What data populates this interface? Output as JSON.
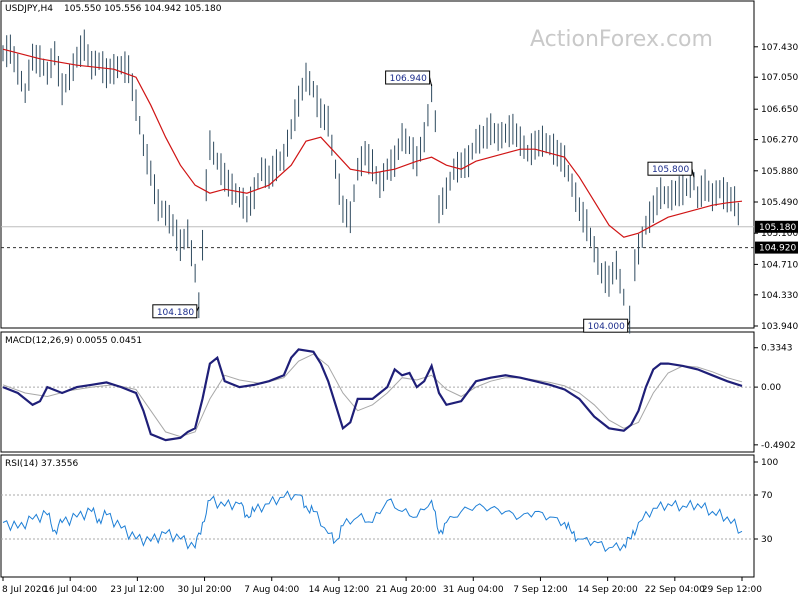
{
  "header": {
    "symbol": "USDJPY,H4",
    "ohlc": "105.550 105.556 104.942 105.180"
  },
  "watermark": "ActionForex.com",
  "chart_data": [
    {
      "type": "line",
      "name": "price",
      "ylim": [
        103.94,
        107.64
      ],
      "y_ticks": [
        "107.430",
        "107.050",
        "106.650",
        "106.270",
        "105.880",
        "105.490",
        "105.100",
        "104.710",
        "104.330",
        "103.940"
      ],
      "tick_values": [
        107.43,
        107.05,
        106.65,
        106.27,
        105.88,
        105.49,
        105.1,
        104.71,
        104.33,
        103.94
      ],
      "current_price_label": "105.180",
      "current_price": 105.18,
      "dashed_level_label": "104.920",
      "dashed_level": 104.92,
      "price_line_color": "#2e4a5e",
      "ma_line_color": "#d01515",
      "callouts": [
        {
          "label": "106.940",
          "value": 106.94,
          "t": 0.58
        },
        {
          "label": "104.180",
          "value": 104.18,
          "t": 0.265
        },
        {
          "label": "105.800",
          "value": 105.8,
          "t": 0.935
        },
        {
          "label": "104.000",
          "value": 104.0,
          "t": 0.848
        }
      ],
      "price_path": [
        [
          0.0,
          107.35
        ],
        [
          0.01,
          107.4
        ],
        [
          0.02,
          107.15
        ],
        [
          0.03,
          106.85
        ],
        [
          0.04,
          107.3
        ],
        [
          0.05,
          107.25
        ],
        [
          0.06,
          107.1
        ],
        [
          0.07,
          107.35
        ],
        [
          0.08,
          106.9
        ],
        [
          0.09,
          107.05
        ],
        [
          0.1,
          107.3
        ],
        [
          0.11,
          107.45
        ],
        [
          0.12,
          107.2
        ],
        [
          0.13,
          107.25
        ],
        [
          0.14,
          107.1
        ],
        [
          0.15,
          107.15
        ],
        [
          0.16,
          107.2
        ],
        [
          0.17,
          107.15
        ],
        [
          0.18,
          106.7
        ],
        [
          0.19,
          106.2
        ],
        [
          0.2,
          105.85
        ],
        [
          0.21,
          105.45
        ],
        [
          0.22,
          105.35
        ],
        [
          0.23,
          105.2
        ],
        [
          0.24,
          104.95
        ],
        [
          0.25,
          105.1
        ],
        [
          0.26,
          104.6
        ],
        [
          0.265,
          104.2
        ],
        [
          0.27,
          104.95
        ],
        [
          0.275,
          105.7
        ],
        [
          0.28,
          106.2
        ],
        [
          0.29,
          106.0
        ],
        [
          0.3,
          105.8
        ],
        [
          0.31,
          105.65
        ],
        [
          0.32,
          105.55
        ],
        [
          0.33,
          105.4
        ],
        [
          0.34,
          105.6
        ],
        [
          0.35,
          105.9
        ],
        [
          0.36,
          105.8
        ],
        [
          0.37,
          105.95
        ],
        [
          0.38,
          106.05
        ],
        [
          0.39,
          106.4
        ],
        [
          0.4,
          106.75
        ],
        [
          0.41,
          107.05
        ],
        [
          0.42,
          106.9
        ],
        [
          0.43,
          106.6
        ],
        [
          0.44,
          106.5
        ],
        [
          0.45,
          105.9
        ],
        [
          0.46,
          105.4
        ],
        [
          0.47,
          105.3
        ],
        [
          0.48,
          105.9
        ],
        [
          0.49,
          106.1
        ],
        [
          0.5,
          105.95
        ],
        [
          0.51,
          105.7
        ],
        [
          0.52,
          105.9
        ],
        [
          0.53,
          106.0
        ],
        [
          0.54,
          106.3
        ],
        [
          0.55,
          106.2
        ],
        [
          0.56,
          106.0
        ],
        [
          0.57,
          106.3
        ],
        [
          0.58,
          106.85
        ],
        [
          0.585,
          106.5
        ],
        [
          0.59,
          105.4
        ],
        [
          0.6,
          105.6
        ],
        [
          0.61,
          105.9
        ],
        [
          0.62,
          105.95
        ],
        [
          0.63,
          106.0
        ],
        [
          0.64,
          106.25
        ],
        [
          0.65,
          106.3
        ],
        [
          0.66,
          106.4
        ],
        [
          0.67,
          106.3
        ],
        [
          0.68,
          106.35
        ],
        [
          0.69,
          106.4
        ],
        [
          0.7,
          106.25
        ],
        [
          0.71,
          106.1
        ],
        [
          0.72,
          106.2
        ],
        [
          0.73,
          106.25
        ],
        [
          0.74,
          106.2
        ],
        [
          0.75,
          106.1
        ],
        [
          0.76,
          106.0
        ],
        [
          0.77,
          105.7
        ],
        [
          0.78,
          105.4
        ],
        [
          0.79,
          105.2
        ],
        [
          0.8,
          104.9
        ],
        [
          0.81,
          104.6
        ],
        [
          0.82,
          104.5
        ],
        [
          0.83,
          104.7
        ],
        [
          0.84,
          104.3
        ],
        [
          0.848,
          104.02
        ],
        [
          0.855,
          104.7
        ],
        [
          0.86,
          104.9
        ],
        [
          0.87,
          105.2
        ],
        [
          0.88,
          105.4
        ],
        [
          0.89,
          105.6
        ],
        [
          0.9,
          105.55
        ],
        [
          0.91,
          105.6
        ],
        [
          0.92,
          105.65
        ],
        [
          0.93,
          105.7
        ],
        [
          0.935,
          105.75
        ],
        [
          0.94,
          105.55
        ],
        [
          0.95,
          105.7
        ],
        [
          0.96,
          105.55
        ],
        [
          0.97,
          105.65
        ],
        [
          0.98,
          105.55
        ],
        [
          0.99,
          105.5
        ],
        [
          1.0,
          105.18
        ]
      ],
      "ma_path": [
        [
          0.0,
          107.4
        ],
        [
          0.05,
          107.28
        ],
        [
          0.1,
          107.2
        ],
        [
          0.15,
          107.15
        ],
        [
          0.18,
          107.05
        ],
        [
          0.2,
          106.7
        ],
        [
          0.22,
          106.3
        ],
        [
          0.24,
          105.95
        ],
        [
          0.26,
          105.7
        ],
        [
          0.28,
          105.6
        ],
        [
          0.3,
          105.65
        ],
        [
          0.33,
          105.6
        ],
        [
          0.36,
          105.7
        ],
        [
          0.39,
          105.95
        ],
        [
          0.41,
          106.25
        ],
        [
          0.43,
          106.3
        ],
        [
          0.45,
          106.1
        ],
        [
          0.47,
          105.9
        ],
        [
          0.5,
          105.85
        ],
        [
          0.53,
          105.9
        ],
        [
          0.56,
          106.0
        ],
        [
          0.58,
          106.05
        ],
        [
          0.6,
          105.95
        ],
        [
          0.62,
          105.9
        ],
        [
          0.64,
          106.0
        ],
        [
          0.66,
          106.05
        ],
        [
          0.68,
          106.1
        ],
        [
          0.7,
          106.15
        ],
        [
          0.72,
          106.15
        ],
        [
          0.74,
          106.1
        ],
        [
          0.76,
          106.05
        ],
        [
          0.78,
          105.8
        ],
        [
          0.8,
          105.5
        ],
        [
          0.82,
          105.2
        ],
        [
          0.84,
          105.05
        ],
        [
          0.86,
          105.1
        ],
        [
          0.88,
          105.2
        ],
        [
          0.9,
          105.3
        ],
        [
          0.92,
          105.35
        ],
        [
          0.94,
          105.4
        ],
        [
          0.96,
          105.45
        ],
        [
          0.98,
          105.48
        ],
        [
          1.0,
          105.5
        ]
      ]
    },
    {
      "type": "line",
      "name": "MACD(12,26,9) 0.0055 0.0451",
      "ylim": [
        -0.5,
        0.4
      ],
      "y_ticks": [
        "0.3343",
        "0.00",
        "-0.4902"
      ],
      "tick_values": [
        0.3343,
        0.0,
        -0.4902
      ],
      "macd_color": "#1f1f78",
      "signal_color": "#a8a8a8",
      "macd_path": [
        [
          0.0,
          0.0
        ],
        [
          0.02,
          -0.05
        ],
        [
          0.04,
          -0.15
        ],
        [
          0.05,
          -0.12
        ],
        [
          0.06,
          0.0
        ],
        [
          0.08,
          -0.05
        ],
        [
          0.1,
          0.0
        ],
        [
          0.12,
          0.02
        ],
        [
          0.14,
          0.04
        ],
        [
          0.16,
          0.0
        ],
        [
          0.18,
          -0.05
        ],
        [
          0.19,
          -0.2
        ],
        [
          0.2,
          -0.4
        ],
        [
          0.22,
          -0.45
        ],
        [
          0.24,
          -0.43
        ],
        [
          0.25,
          -0.38
        ],
        [
          0.26,
          -0.35
        ],
        [
          0.27,
          -0.1
        ],
        [
          0.28,
          0.2
        ],
        [
          0.29,
          0.25
        ],
        [
          0.3,
          0.05
        ],
        [
          0.32,
          0.0
        ],
        [
          0.34,
          0.02
        ],
        [
          0.36,
          0.05
        ],
        [
          0.38,
          0.1
        ],
        [
          0.39,
          0.25
        ],
        [
          0.4,
          0.32
        ],
        [
          0.42,
          0.3
        ],
        [
          0.43,
          0.2
        ],
        [
          0.44,
          0.05
        ],
        [
          0.45,
          -0.15
        ],
        [
          0.46,
          -0.35
        ],
        [
          0.47,
          -0.3
        ],
        [
          0.48,
          -0.1
        ],
        [
          0.5,
          -0.1
        ],
        [
          0.52,
          0.0
        ],
        [
          0.53,
          0.15
        ],
        [
          0.54,
          0.1
        ],
        [
          0.55,
          0.12
        ],
        [
          0.56,
          0.0
        ],
        [
          0.57,
          0.05
        ],
        [
          0.58,
          0.18
        ],
        [
          0.59,
          -0.05
        ],
        [
          0.6,
          -0.15
        ],
        [
          0.62,
          -0.12
        ],
        [
          0.64,
          0.05
        ],
        [
          0.66,
          0.08
        ],
        [
          0.68,
          0.1
        ],
        [
          0.7,
          0.08
        ],
        [
          0.72,
          0.05
        ],
        [
          0.74,
          0.02
        ],
        [
          0.76,
          -0.02
        ],
        [
          0.78,
          -0.1
        ],
        [
          0.8,
          -0.25
        ],
        [
          0.82,
          -0.35
        ],
        [
          0.84,
          -0.37
        ],
        [
          0.85,
          -0.32
        ],
        [
          0.86,
          -0.2
        ],
        [
          0.87,
          0.0
        ],
        [
          0.88,
          0.15
        ],
        [
          0.89,
          0.2
        ],
        [
          0.9,
          0.2
        ],
        [
          0.92,
          0.18
        ],
        [
          0.94,
          0.15
        ],
        [
          0.96,
          0.1
        ],
        [
          0.98,
          0.05
        ],
        [
          1.0,
          0.01
        ]
      ],
      "signal_path": [
        [
          0.0,
          0.02
        ],
        [
          0.03,
          -0.05
        ],
        [
          0.06,
          -0.08
        ],
        [
          0.09,
          -0.03
        ],
        [
          0.12,
          0.0
        ],
        [
          0.15,
          0.02
        ],
        [
          0.18,
          -0.02
        ],
        [
          0.2,
          -0.2
        ],
        [
          0.22,
          -0.38
        ],
        [
          0.24,
          -0.42
        ],
        [
          0.26,
          -0.38
        ],
        [
          0.28,
          -0.1
        ],
        [
          0.3,
          0.1
        ],
        [
          0.32,
          0.06
        ],
        [
          0.35,
          0.03
        ],
        [
          0.38,
          0.08
        ],
        [
          0.4,
          0.22
        ],
        [
          0.42,
          0.28
        ],
        [
          0.44,
          0.18
        ],
        [
          0.46,
          -0.05
        ],
        [
          0.48,
          -0.2
        ],
        [
          0.5,
          -0.15
        ],
        [
          0.52,
          -0.05
        ],
        [
          0.54,
          0.08
        ],
        [
          0.56,
          0.06
        ],
        [
          0.58,
          0.1
        ],
        [
          0.6,
          -0.02
        ],
        [
          0.62,
          -0.08
        ],
        [
          0.64,
          0.0
        ],
        [
          0.66,
          0.05
        ],
        [
          0.68,
          0.08
        ],
        [
          0.7,
          0.08
        ],
        [
          0.72,
          0.06
        ],
        [
          0.74,
          0.04
        ],
        [
          0.76,
          0.01
        ],
        [
          0.78,
          -0.05
        ],
        [
          0.8,
          -0.15
        ],
        [
          0.82,
          -0.28
        ],
        [
          0.84,
          -0.35
        ],
        [
          0.86,
          -0.3
        ],
        [
          0.88,
          -0.05
        ],
        [
          0.9,
          0.12
        ],
        [
          0.92,
          0.18
        ],
        [
          0.94,
          0.17
        ],
        [
          0.96,
          0.13
        ],
        [
          0.98,
          0.08
        ],
        [
          1.0,
          0.045
        ]
      ]
    },
    {
      "type": "line",
      "name": "RSI(14) 37.3556",
      "ylim": [
        0,
        100
      ],
      "y_ticks": [
        "100",
        "70",
        "30"
      ],
      "tick_values": [
        100,
        70,
        30
      ],
      "rsi_color": "#1e7fd6",
      "rsi_path": [
        [
          0.0,
          45
        ],
        [
          0.02,
          40
        ],
        [
          0.04,
          48
        ],
        [
          0.06,
          52
        ],
        [
          0.07,
          38
        ],
        [
          0.08,
          45
        ],
        [
          0.1,
          50
        ],
        [
          0.12,
          55
        ],
        [
          0.13,
          48
        ],
        [
          0.14,
          52
        ],
        [
          0.16,
          40
        ],
        [
          0.18,
          30
        ],
        [
          0.2,
          28
        ],
        [
          0.22,
          35
        ],
        [
          0.24,
          30
        ],
        [
          0.26,
          22
        ],
        [
          0.27,
          45
        ],
        [
          0.28,
          65
        ],
        [
          0.3,
          60
        ],
        [
          0.32,
          62
        ],
        [
          0.33,
          52
        ],
        [
          0.34,
          55
        ],
        [
          0.36,
          62
        ],
        [
          0.38,
          68
        ],
        [
          0.4,
          70
        ],
        [
          0.41,
          60
        ],
        [
          0.42,
          55
        ],
        [
          0.44,
          35
        ],
        [
          0.45,
          28
        ],
        [
          0.46,
          42
        ],
        [
          0.48,
          50
        ],
        [
          0.5,
          45
        ],
        [
          0.52,
          65
        ],
        [
          0.54,
          55
        ],
        [
          0.56,
          50
        ],
        [
          0.58,
          65
        ],
        [
          0.59,
          35
        ],
        [
          0.6,
          45
        ],
        [
          0.62,
          55
        ],
        [
          0.64,
          60
        ],
        [
          0.66,
          58
        ],
        [
          0.68,
          55
        ],
        [
          0.7,
          50
        ],
        [
          0.72,
          55
        ],
        [
          0.74,
          50
        ],
        [
          0.76,
          45
        ],
        [
          0.77,
          35
        ],
        [
          0.78,
          30
        ],
        [
          0.8,
          28
        ],
        [
          0.82,
          22
        ],
        [
          0.84,
          25
        ],
        [
          0.85,
          30
        ],
        [
          0.86,
          45
        ],
        [
          0.88,
          58
        ],
        [
          0.9,
          62
        ],
        [
          0.92,
          60
        ],
        [
          0.94,
          62
        ],
        [
          0.96,
          55
        ],
        [
          0.98,
          50
        ],
        [
          1.0,
          37
        ]
      ]
    }
  ],
  "x_axis": {
    "labels": [
      "8 Jul 2020",
      "16 Jul 04:00",
      "23 Jul 12:00",
      "30 Jul 20:00",
      "7 Aug 04:00",
      "14 Aug 12:00",
      "21 Aug 20:00",
      "31 Aug 04:00",
      "7 Sep 12:00",
      "14 Sep 20:00",
      "22 Sep 04:00",
      "29 Sep 12:00"
    ]
  }
}
